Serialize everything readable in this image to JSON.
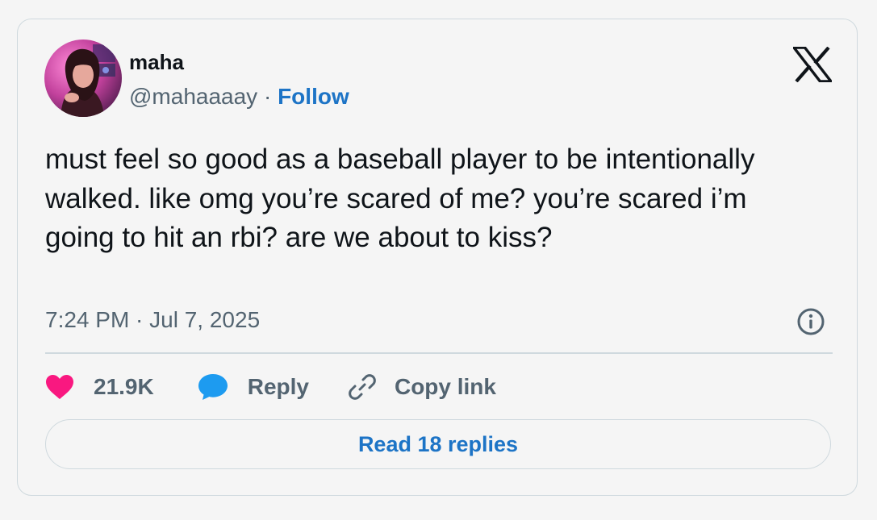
{
  "author": {
    "name": "maha",
    "handle": "@mahaaaay",
    "separator": " · ",
    "follow_label": "Follow",
    "avatar_icon": "profile-photo"
  },
  "tweet": {
    "text": "must feel so good as a baseball player to be intentionally walked. like omg you’re scared of me? you’re scared i’m going to hit an rbi? are we about to kiss?",
    "timestamp": "7:24 PM · Jul 7, 2025"
  },
  "actions": {
    "like_count": "21.9K",
    "reply_label": "Reply",
    "copy_link_label": "Copy link"
  },
  "read_replies_label": "Read 18 replies",
  "icons": {
    "platform_logo": "x-logo-icon",
    "info": "info-icon",
    "like": "heart-icon",
    "reply": "speech-bubble-icon",
    "copy": "link-icon"
  },
  "colors": {
    "link": "#1d74c6",
    "heart": "#f91880",
    "reply_bubble": "#1d9bf0",
    "muted_text": "#536471",
    "text": "#0f1419",
    "border": "#cfd9de"
  }
}
